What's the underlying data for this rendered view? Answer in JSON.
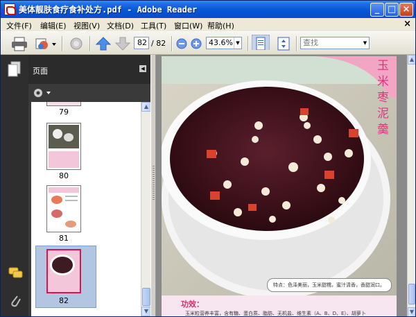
{
  "window": {
    "title": "美体靓肤食疗食补处方.pdf - Adobe Reader",
    "minimize_label": "_",
    "maximize_label": "□",
    "close_label": "×"
  },
  "menu": {
    "items": [
      "文件(F)",
      "编辑(E)",
      "视图(V)",
      "文档(D)",
      "工具(T)",
      "窗口(W)",
      "帮助(H)"
    ],
    "doc_close": "×"
  },
  "toolbar": {
    "current_page": "82",
    "total_pages": "/ 82",
    "zoom": "43.6%",
    "search_placeholder": "查找"
  },
  "pages_panel": {
    "title": "页面",
    "thumbnails": [
      {
        "label": "79"
      },
      {
        "label": "80"
      },
      {
        "label": "81"
      },
      {
        "label": "82"
      }
    ]
  },
  "document": {
    "vertical_title": "玉米枣泥羹",
    "caption": "特点：色泽美丽，玉米甜糯，蜜汁清香，香甜润口。",
    "section_heading": "功效：",
    "body_line": "玉米粒营养丰富，含有糖、蛋白质、脂肪、无机盐、维生素（A、B、D、E）、胡萝卜"
  },
  "colors": {
    "titlebar": "#0a58d6",
    "accent_pink": "#e0357e",
    "panel_dark": "#2e2e2e"
  }
}
